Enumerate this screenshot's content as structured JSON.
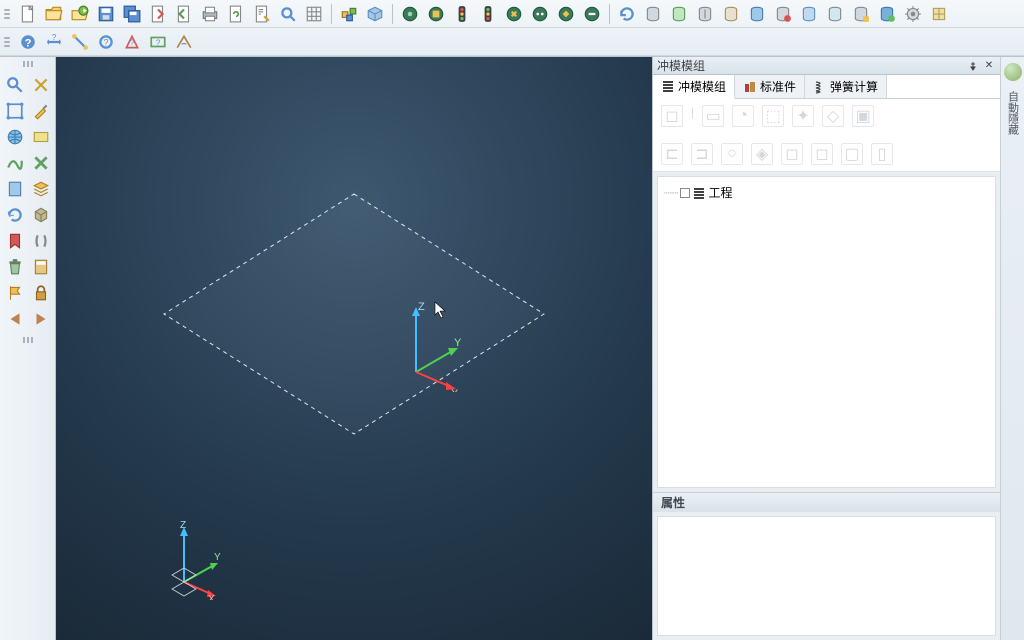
{
  "panel": {
    "title": "冲模模组",
    "pin": "⬙",
    "close": "✕"
  },
  "tabs": [
    {
      "label": "冲模模组",
      "icon": "module-icon",
      "active": true
    },
    {
      "label": "标准件",
      "icon": "standard-icon",
      "active": false
    },
    {
      "label": "弹簧计算",
      "icon": "spring-icon",
      "active": false
    }
  ],
  "tree": {
    "root_label": "工程"
  },
  "properties": {
    "heading": "属性"
  },
  "far_right": {
    "label": "自動隱藏"
  },
  "axes": {
    "x": "X",
    "y": "Y",
    "z": "Z"
  }
}
